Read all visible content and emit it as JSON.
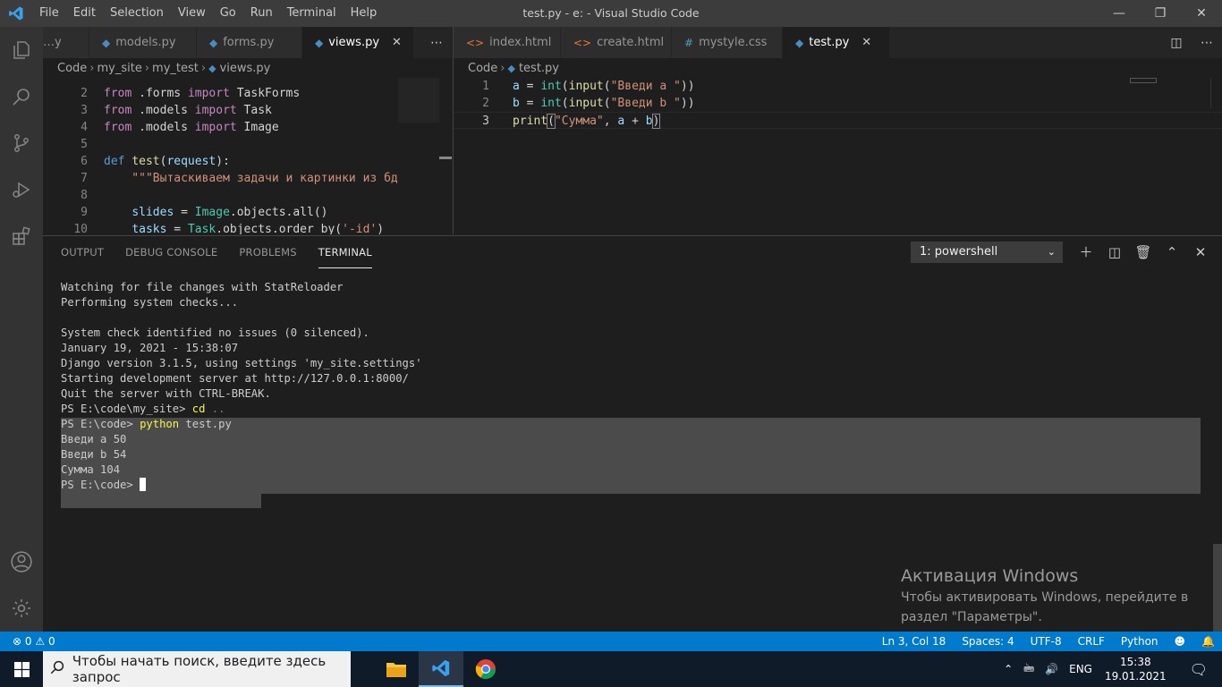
{
  "window": {
    "title": "test.py - e: - Visual Studio Code",
    "menu": [
      "File",
      "Edit",
      "Selection",
      "View",
      "Go",
      "Run",
      "Terminal",
      "Help"
    ]
  },
  "left_editor": {
    "tabs": [
      {
        "label": "models.py",
        "icon": "python-icon"
      },
      {
        "label": "forms.py",
        "icon": "python-icon"
      },
      {
        "label": "views.py",
        "icon": "python-icon",
        "active": true
      }
    ],
    "breadcrumb": [
      "Code",
      "my_site",
      "my_test",
      "views.py"
    ],
    "lines": [
      {
        "n": "2",
        "code": "from .forms import TaskForms"
      },
      {
        "n": "3",
        "code": "from .models import Task"
      },
      {
        "n": "4",
        "code": "from .models import Image"
      },
      {
        "n": "5",
        "code": ""
      },
      {
        "n": "6",
        "code": "def test(request):"
      },
      {
        "n": "7",
        "code": "    \"\"\"Вытаскиваем задачи и картинки из бд"
      },
      {
        "n": "8",
        "code": ""
      },
      {
        "n": "9",
        "code": "    slides = Image.objects.all()"
      },
      {
        "n": "10",
        "code": "    tasks = Task.objects.order_by('-id')"
      }
    ]
  },
  "right_editor": {
    "tabs": [
      {
        "label": "index.html",
        "icon": "html-icon"
      },
      {
        "label": "create.html",
        "icon": "html-icon"
      },
      {
        "label": "mystyle.css",
        "icon": "css-icon"
      },
      {
        "label": "test.py",
        "icon": "python-icon",
        "active": true
      }
    ],
    "breadcrumb": [
      "Code",
      "test.py"
    ],
    "lines": [
      {
        "n": "1",
        "code": "a = int(input(\"Введи a \"))"
      },
      {
        "n": "2",
        "code": "b = int(input(\"Введи b \"))"
      },
      {
        "n": "3",
        "code": "print(\"Сумма\", a + b)"
      }
    ]
  },
  "panel": {
    "tabs": [
      "OUTPUT",
      "DEBUG CONSOLE",
      "PROBLEMS",
      "TERMINAL"
    ],
    "active_tab": "TERMINAL",
    "terminal_select": "1: powershell",
    "terminal_lines": [
      "Watching for file changes with StatReloader",
      "Performing system checks...",
      "",
      "System check identified no issues (0 silenced).",
      "January 19, 2021 - 15:38:07",
      "Django version 3.1.5, using settings 'my_site.settings'",
      "Starting development server at http://127.0.0.1:8000/",
      "Quit the server with CTRL-BREAK.",
      "PS E:\\code\\my_site> cd ..",
      "PS E:\\code> python test.py",
      "Введи a 50",
      "Введи b 54",
      "Сумма 104",
      "PS E:\\code> "
    ]
  },
  "activation": {
    "title": "Активация Windows",
    "line1": "Чтобы активировать Windows, перейдите в",
    "line2": "раздел \"Параметры\"."
  },
  "statusbar": {
    "errors": "0",
    "warnings": "0",
    "position": "Ln 3, Col 18",
    "spaces": "Spaces: 4",
    "encoding": "UTF-8",
    "eol": "CRLF",
    "language": "Python"
  },
  "taskbar": {
    "search_placeholder": "Чтобы начать поиск, введите здесь запрос",
    "lang": "ENG",
    "time": "15:38",
    "date": "19.01.2021"
  },
  "colors": {
    "accent": "#007acc",
    "titlebar": "#3c3c3c",
    "editor_bg": "#1e1e1e"
  }
}
